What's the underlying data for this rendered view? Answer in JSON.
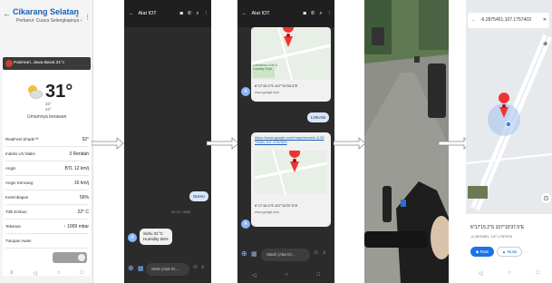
{
  "panel1": {
    "title": "Cikarang Selatan",
    "subtitle": "Perbarui: Cuaca Selengkapnya ›",
    "weather_bar": "Pasirsari, Jawa Barat  31°c",
    "temperature": "31°",
    "hilo": [
      "32°",
      "22°"
    ],
    "condition": "Umumnya berawan",
    "rows": [
      {
        "label": "RealFeel Shade™",
        "value": "32°"
      },
      {
        "label": "Indeks UV Maks",
        "value": "3 Rendah"
      },
      {
        "label": "Angin",
        "value": "BTL 12 km/j"
      },
      {
        "label": "Angin Kencang",
        "value": "16 km/j"
      },
      {
        "label": "Kelembapan",
        "value": "56%"
      },
      {
        "label": "Titik Embun",
        "value": "22° C"
      },
      {
        "label": "Tekanan",
        "value": "↑ 1009 mbar"
      },
      {
        "label": "Tutupan Awan",
        "value": ""
      }
    ]
  },
  "panel2": {
    "title": "Alat IOT",
    "sent_msg": "SUHU",
    "sent_time": "09.12 • SMS",
    "reply_line1": "Suhu 31°C",
    "reply_line2": "Humidity 56%",
    "avatar": "A",
    "input_placeholder": "SMS (Alat IO...",
    "date_label": "09.12"
  },
  "panel3": {
    "title": "Alat IOT",
    "map1_label": "Lababeka Golf & Country Club",
    "coords1": "6°17'15.2\"S 107°10'33.3\"E",
    "url1": "www.google.com",
    "sent_msg": "LOKASI",
    "link": "https://www.google.com/maps/search/-6.2875451,107.1757403",
    "coords2": "6°17'15.2\"S 107°10'37.5\"E",
    "url2": "www.google.com",
    "avatar": "A",
    "input_placeholder": "Slash (Alat IO..."
  },
  "panel5": {
    "search_text": "-6.2875451,107.1757403",
    "coords": "6°17'15.2\"S 107°10'37.5\"E",
    "sub": "-6.2875451, 107.1757403",
    "btn1": "Rute",
    "btn2": "Mulai"
  }
}
